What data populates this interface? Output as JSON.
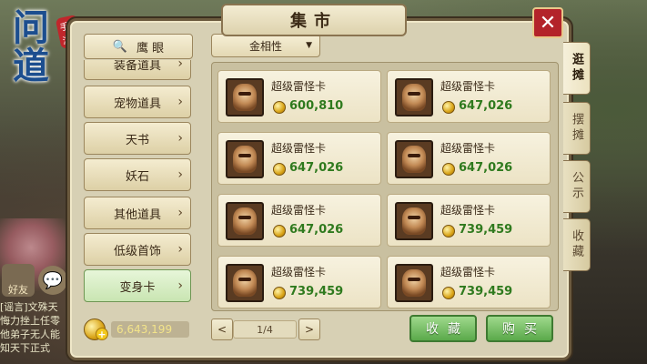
{
  "game_logo": {
    "text": "问道",
    "tag": "手游"
  },
  "window": {
    "title": "集市",
    "close_label": "✕"
  },
  "search": {
    "label": "鹰 眼",
    "icon": "search-icon"
  },
  "categories": [
    {
      "label": "装备道具"
    },
    {
      "label": "宠物道具"
    },
    {
      "label": "天书"
    },
    {
      "label": "妖石"
    },
    {
      "label": "其他道具"
    },
    {
      "label": "低级首饰"
    },
    {
      "label": "变身卡",
      "active": true
    }
  ],
  "filter": {
    "selected": "金相性"
  },
  "items": [
    {
      "name": "超级雷怪卡",
      "price": "600,810"
    },
    {
      "name": "超级雷怪卡",
      "price": "647,026"
    },
    {
      "name": "超级雷怪卡",
      "price": "647,026"
    },
    {
      "name": "超级雷怪卡",
      "price": "647,026"
    },
    {
      "name": "超级雷怪卡",
      "price": "647,026"
    },
    {
      "name": "超级雷怪卡",
      "price": "739,459"
    },
    {
      "name": "超级雷怪卡",
      "price": "739,459"
    },
    {
      "name": "超级雷怪卡",
      "price": "739,459"
    }
  ],
  "currency": {
    "amount": "6,643,199"
  },
  "pagination": {
    "label": "1/4",
    "prev": "<",
    "next": ">"
  },
  "actions": {
    "favorite": "收藏",
    "buy": "购买"
  },
  "side_tabs": [
    {
      "label": "逛摊",
      "active": true
    },
    {
      "label": "摆摊"
    },
    {
      "label": "公示"
    },
    {
      "label": "收藏"
    }
  ],
  "chat": {
    "friend_label": "好友",
    "lines": [
      "[谣言]文殊天",
      "悔力挫上任零",
      "他弟子无人能",
      "知天下正式"
    ]
  },
  "colors": {
    "price": "#2f7a1e",
    "active_green": "#5aa94a",
    "close_red": "#b3232a"
  }
}
